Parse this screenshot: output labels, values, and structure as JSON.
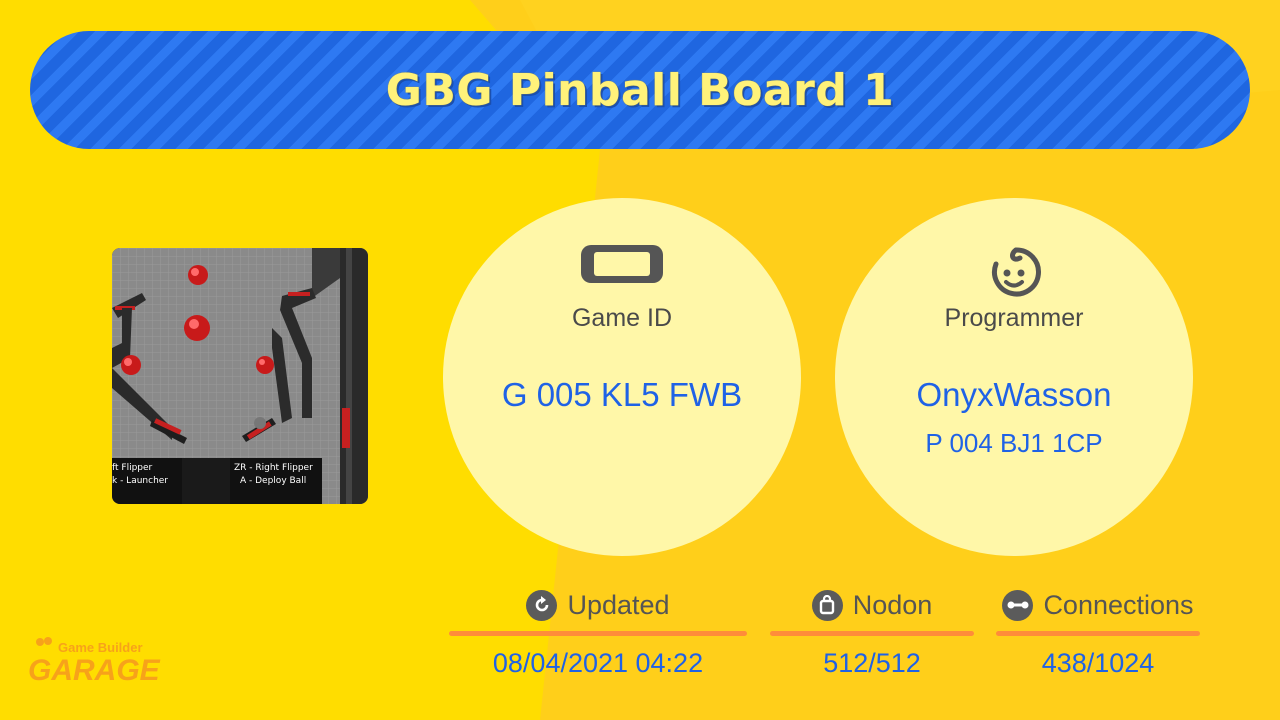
{
  "title": "GBG Pinball Board 1",
  "thumbnail": {
    "caption_left_1": "ft Flipper",
    "caption_left_2": "k - Launcher",
    "caption_right_1": "ZR - Right Flipper",
    "caption_right_2": "A - Deploy Ball"
  },
  "game_id": {
    "label": "Game ID",
    "value": "G 005 KL5 FWB",
    "icon": "console-icon"
  },
  "programmer": {
    "label": "Programmer",
    "name": "OnyxWasson",
    "id": "P 004 BJ1 1CP",
    "icon": "face-icon"
  },
  "stats": [
    {
      "label": "Updated",
      "value": "08/04/2021 04:22",
      "icon": "refresh-icon"
    },
    {
      "label": "Nodon",
      "value": "512/512",
      "icon": "bag-icon"
    },
    {
      "label": "Connections",
      "value": "438/1024",
      "icon": "link-icon"
    }
  ],
  "logo": {
    "line1": "Game Builder",
    "line2": "GARAGE"
  },
  "colors": {
    "background": "#ffdd00",
    "banner": "#1f66e0",
    "title": "#fff27a",
    "accent_value": "#1f62e6",
    "underline": "#ff8c3a"
  }
}
